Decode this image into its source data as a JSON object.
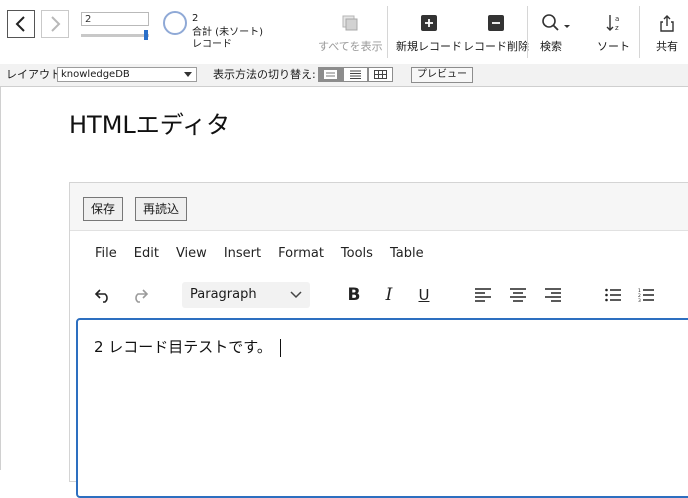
{
  "toolbar": {
    "record_value": "2",
    "record_slider_value": 1.0,
    "found_count": "2",
    "total_label": "合計 (未ソート)",
    "unit_label": "レコード",
    "buttons": {
      "show_all": "すべてを表示",
      "new_record": "新規レコード",
      "delete_record": "レコード削除",
      "search": "検索",
      "sort": "ソート",
      "share": "共有"
    }
  },
  "layoutbar": {
    "layout_label": "レイアウト:",
    "layout_value": "knowledgeDB",
    "view_label": "表示方法の切り替え:",
    "preview_label": "プレビュー"
  },
  "content": {
    "title": "HTMLエディタ",
    "save_label": "保存",
    "reload_label": "再読込",
    "menu": [
      "File",
      "Edit",
      "View",
      "Insert",
      "Format",
      "Tools",
      "Table"
    ],
    "paragraph_label": "Paragraph",
    "editor_text": "2 レコード目テストです。"
  },
  "icons": {
    "back": "chevron-left-icon",
    "forward": "chevron-right-icon",
    "show_all": "stack-icon",
    "new_record": "plus-square-icon",
    "delete_record": "minus-square-icon",
    "search": "search-icon",
    "sort": "sort-az-icon",
    "share": "share-icon"
  },
  "colors": {
    "accent": "#2d6fc0",
    "slider": "#2a6fc9",
    "pie": "#8fa9d6"
  }
}
